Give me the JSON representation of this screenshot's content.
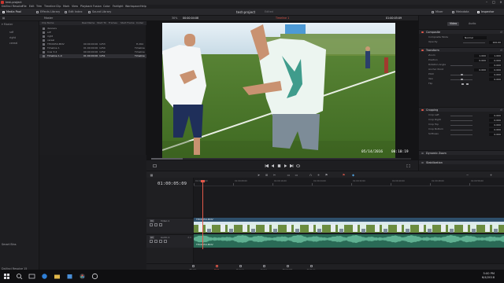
{
  "window": {
    "title": "test-project"
  },
  "menu": [
    "DaVinci Resolve",
    "File",
    "Edit",
    "Trim",
    "Timeline",
    "Clip",
    "Mark",
    "View",
    "Playback",
    "Fusion",
    "Color",
    "Fairlight",
    "Workspace",
    "Help"
  ],
  "toolbar": {
    "media_pool": "Media Pool",
    "effects_library": "Effects Library",
    "edit_index": "Edit Index",
    "sound_library": "Sound Library",
    "project_title": "test-project",
    "project_status": "Edited",
    "mixer": "Mixer",
    "metadata": "Metadata",
    "inspector": "Inspector"
  },
  "subbar": {
    "bin_name": "Master",
    "zoom": "30%",
    "source_tc": "00:00:04:08",
    "clip_title": "Timeline 1",
    "record_tc": "01:00:05:09",
    "inspector_clip": "THC0054.MOV"
  },
  "bins": {
    "master_label": "Master",
    "items": [
      "sdf",
      "right",
      "cereal"
    ],
    "smart_bins": "Smart Bins"
  },
  "media_pool": {
    "headers": [
      "Clip Name",
      "Reel Name",
      "Start TC",
      "Frames",
      "Start Frame",
      "Codec"
    ],
    "rows": [
      {
        "name": "dancers",
        "tc": "",
        "frames": "",
        "codec": ""
      },
      {
        "name": "sdf",
        "tc": "",
        "frames": "",
        "codec": ""
      },
      {
        "name": "right",
        "tc": "",
        "frames": "",
        "codec": ""
      },
      {
        "name": "cereal",
        "tc": "",
        "frames": "",
        "codec": ""
      },
      {
        "name": "THC0054.MOV",
        "tc": "00:00:00:00",
        "frames": "1253",
        "codec": "H.264"
      },
      {
        "name": "Timeline 1",
        "tc": "01:00:00:00",
        "frames": "1254",
        "codec": "Timeline"
      },
      {
        "name": "Cow 3-4",
        "tc": "00:00:00:00",
        "frames": "1252",
        "codec": "Timeline"
      },
      {
        "name": "Timeline 1-4",
        "tc": "01:00:00:00",
        "frames": "1251",
        "codec": "Timeline"
      }
    ]
  },
  "viewer": {
    "overlay_date": "05/14/2016",
    "overlay_time": "00:10:19"
  },
  "inspector": {
    "tabs": [
      "Video",
      "Audio"
    ],
    "sections": {
      "composite": "Composite",
      "transform": "Transform",
      "cropping": "Cropping",
      "dynamic_zoom": "Dynamic Zoom",
      "stabilization": "Stabilization"
    },
    "composite_params": [
      {
        "label": "Composite Mode",
        "value": "Normal"
      },
      {
        "label": "Opacity",
        "value": "100.00"
      }
    ],
    "transform_params": [
      {
        "label": "Zoom",
        "x": "1.000",
        "y": "1.000"
      },
      {
        "label": "Position",
        "x": "0.000",
        "y": "0.000"
      },
      {
        "label": "Rotation Angle",
        "x": "0.000",
        "y": ""
      },
      {
        "label": "Anchor Point",
        "x": "0.000",
        "y": "0.000"
      },
      {
        "label": "Pitch",
        "x": "0.000",
        "y": ""
      },
      {
        "label": "Yaw",
        "x": "0.000",
        "y": ""
      },
      {
        "label": "Flip",
        "x": "",
        "y": ""
      }
    ],
    "cropping_params": [
      {
        "label": "Crop Left",
        "value": "0.000"
      },
      {
        "label": "Crop Right",
        "value": "0.000"
      },
      {
        "label": "Crop Top",
        "value": "0.000"
      },
      {
        "label": "Crop Bottom",
        "value": "0.000"
      },
      {
        "label": "Softness",
        "value": "0.000"
      }
    ],
    "reset": "Reset"
  },
  "timeline": {
    "timecode": "01:00:05:09",
    "ruler": [
      "01:00:00:00",
      "01:00:08:00",
      "01:00:16:00",
      "01:00:24:00",
      "01:00:32:00",
      "01:00:40:00",
      "01:00:48:00",
      "01:00:56:00"
    ],
    "video_track": {
      "id": "V1",
      "name": "Video 1",
      "clip": "THC0054.MOV"
    },
    "audio_track": {
      "id": "A1",
      "name": "Audio 1",
      "channels": "2.0",
      "clip": "THC0054.MOV"
    }
  },
  "pages": [
    "Media",
    "Edit",
    "Fusion",
    "Color",
    "Fairlight",
    "Deliver"
  ],
  "active_page": "Edit",
  "app_brand": "DaVinci Resolve 15",
  "taskbar": {
    "time": "5:00 PM",
    "date": "6/4/2018"
  },
  "colors": {
    "accent": "#e3584a",
    "video_clip": "#2e4f6b",
    "audio_clip": "#2a6a56"
  }
}
